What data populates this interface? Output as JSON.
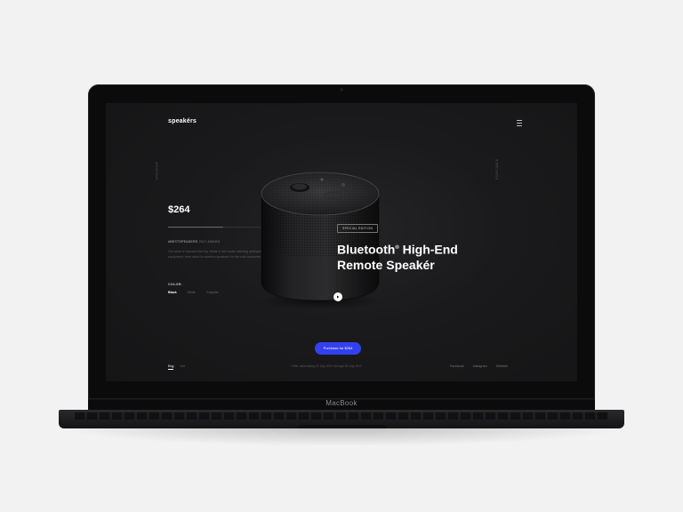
{
  "device": {
    "label": "MacBook"
  },
  "app": {
    "logo": "speakérs"
  },
  "side_labels": {
    "left": "SPEAKER",
    "right": "PORTABLE"
  },
  "product": {
    "price": "$264",
    "award_tag": "#BESTSPEAKERS",
    "award_year": "2017 AWARD",
    "description": "Our store is focused first top create & sell music listening audiophile equipment: from wired to wireless speakers for the real consumer.",
    "color_title": "COLOR:",
    "colors": [
      "Black",
      "White",
      "Graphite"
    ],
    "selected_color": "Black",
    "badge": "SPECIAL EDITION",
    "title_part1": "Bluetooth",
    "title_trademark": "®",
    "title_part2": " High-End",
    "title_line2": "Remote Speakér"
  },
  "actions": {
    "purchase_label": "Purchase for $264"
  },
  "footer": {
    "languages": [
      "Eng",
      "Ukr"
    ],
    "active_language": "Eng",
    "promo": "*Offer valid during 21 July 2017 through 28 July 2017",
    "social": [
      "Facebook",
      "Instagram",
      "Dribbble"
    ]
  },
  "icons": {
    "menu": "hamburger-icon",
    "play": "play-icon",
    "speaker": "speaker-product-image"
  },
  "colors_theme": {
    "accent": "#3340f0",
    "screen_bg": "#1a1a1c",
    "text_primary": "#ffffff"
  }
}
